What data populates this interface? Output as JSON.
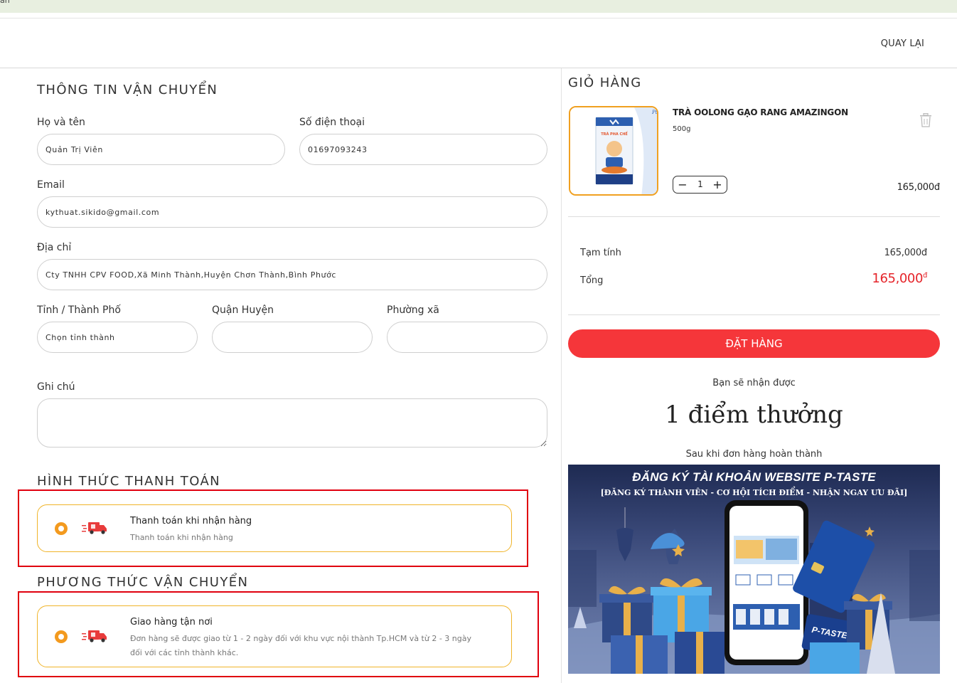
{
  "topbar": {
    "clipped_text": "an"
  },
  "header": {
    "back_label": "QUAY LẠI"
  },
  "shipping": {
    "title": "THÔNG TIN VẬN CHUYỂN",
    "name_label": "Họ và tên",
    "name_value": "Quản Trị Viên",
    "phone_label": "Số điện thoại",
    "phone_value": "01697093243",
    "email_label": "Email",
    "email_value": "kythuat.sikido@gmail.com",
    "address_label": "Địa chỉ",
    "address_value": "Cty TNHH CPV FOOD,Xã Minh Thành,Huyện Chơn Thành,Bình Phước",
    "province_label": "Tỉnh / Thành Phố",
    "province_value": "Chọn tỉnh thành",
    "district_label": "Quận Huyện",
    "district_value": "",
    "ward_label": "Phường xã",
    "ward_value": "",
    "note_label": "Ghi chú",
    "note_value": ""
  },
  "payment": {
    "title": "HÌNH THỨC THANH TOÁN",
    "option_title": "Thanh toán khi nhận hàng",
    "option_desc": "Thanh toán khi nhận hàng"
  },
  "delivery": {
    "title": "PHƯƠNG THỨC VẬN CHUYỂN",
    "option_title": "Giao hàng tận nơi",
    "option_desc": "Đơn hàng sẽ được giao từ 1 - 2 ngày đối với khu vực nội thành Tp.HCM và từ 2 - 3 ngày đối với các tỉnh thành khác."
  },
  "cart": {
    "title": "GIỎ HÀNG",
    "item": {
      "name": "TRÀ OOLONG GẠO RANG AMAZINGON",
      "variant": "500g",
      "quantity": "1",
      "price": "165,000đ",
      "package_label": "TRÀ PHA CHẾ"
    },
    "subtotal_label": "Tạm tính",
    "subtotal_value": "165,000đ",
    "total_label": "Tổng",
    "total_value": "165,000",
    "total_currency": "đ",
    "order_button": "ĐẶT HÀNG",
    "points_pre": "Bạn sẽ nhận được",
    "points_main": "1 điểm thưởng",
    "points_post": "Sau khi đơn hàng hoàn thành"
  },
  "banner": {
    "headline": "ĐĂNG KÝ TÀI KHOẢN WEBSITE P-TASTE",
    "subline": "[ĐĂNG KÝ THÀNH VIÊN - CƠ HỘI TÍCH ĐIỂM - NHẬN NGAY ƯU ĐÃI]",
    "card_label": "P-TASTE"
  },
  "colors": {
    "accent_red": "#f5363a",
    "radio_orange": "#f39a1e",
    "highlight_red": "#e0000f"
  }
}
